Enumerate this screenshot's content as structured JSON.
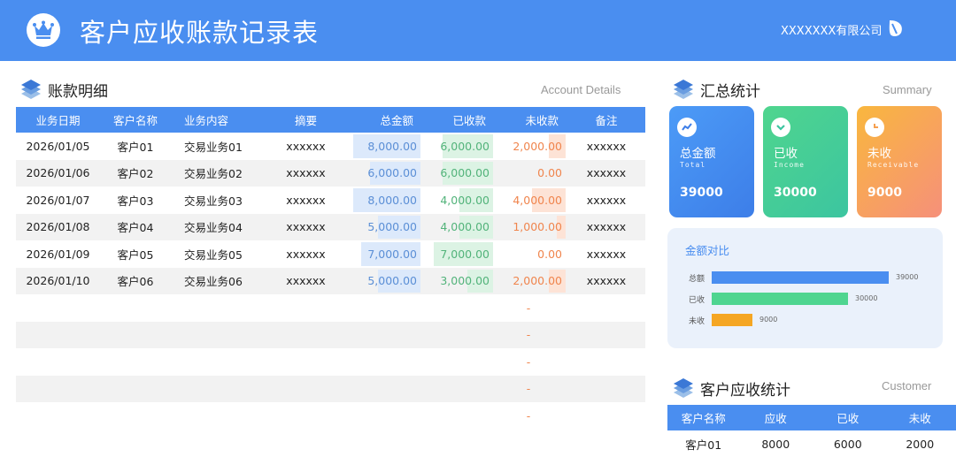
{
  "header": {
    "title": "客户应收账款记录表",
    "company": "XXXXXXX有限公司",
    "bg_color": "#4a8ef0"
  },
  "details": {
    "heading": "账款明细",
    "heading_en": "Account Details",
    "columns": [
      "业务日期",
      "客户名称",
      "业务内容",
      "摘要",
      "总金额",
      "已收款",
      "未收款",
      "备注"
    ],
    "max_amount": 8000,
    "rows": [
      {
        "date": "2026/01/05",
        "customer": "客户01",
        "content": "交易业务01",
        "summary": "xxxxxx",
        "total": "8,000.00",
        "received": "6,000.00",
        "outstanding": "2,000.00",
        "note": "xxxxxx",
        "total_v": 8000,
        "received_v": 6000,
        "outstanding_v": 2000
      },
      {
        "date": "2026/01/06",
        "customer": "客户02",
        "content": "交易业务02",
        "summary": "xxxxxx",
        "total": "6,000.00",
        "received": "6,000.00",
        "outstanding": "0.00",
        "note": "xxxxxx",
        "total_v": 6000,
        "received_v": 6000,
        "outstanding_v": 0
      },
      {
        "date": "2026/01/07",
        "customer": "客户03",
        "content": "交易业务03",
        "summary": "xxxxxx",
        "total": "8,000.00",
        "received": "4,000.00",
        "outstanding": "4,000.00",
        "note": "xxxxxx",
        "total_v": 8000,
        "received_v": 4000,
        "outstanding_v": 4000
      },
      {
        "date": "2026/01/08",
        "customer": "客户04",
        "content": "交易业务04",
        "summary": "xxxxxx",
        "total": "5,000.00",
        "received": "4,000.00",
        "outstanding": "1,000.00",
        "note": "xxxxxx",
        "total_v": 5000,
        "received_v": 4000,
        "outstanding_v": 1000
      },
      {
        "date": "2026/01/09",
        "customer": "客户05",
        "content": "交易业务05",
        "summary": "xxxxxx",
        "total": "7,000.00",
        "received": "7,000.00",
        "outstanding": "0.00",
        "note": "xxxxxx",
        "total_v": 7000,
        "received_v": 7000,
        "outstanding_v": 0
      },
      {
        "date": "2026/01/10",
        "customer": "客户06",
        "content": "交易业务06",
        "summary": "xxxxxx",
        "total": "5,000.00",
        "received": "3,000.00",
        "outstanding": "2,000.00",
        "note": "xxxxxx",
        "total_v": 5000,
        "received_v": 3000,
        "outstanding_v": 2000
      }
    ],
    "empty_placeholder": "-"
  },
  "summary": {
    "heading": "汇总统计",
    "heading_en": "Summary",
    "cards": [
      {
        "name": "总金额",
        "name_en": "Total",
        "value": "39000",
        "color_from": "#4c9bf7",
        "color_to": "#3d7ee8",
        "icon": "trend-icon"
      },
      {
        "name": "已收",
        "name_en": "Income",
        "value": "30000",
        "color_from": "#4fd58e",
        "color_to": "#3cc5a0",
        "icon": "check-icon"
      },
      {
        "name": "未收",
        "name_en": "Receivable",
        "value": "9000",
        "color_from": "#f9b73e",
        "color_to": "#f6907a",
        "icon": "clock-icon"
      }
    ]
  },
  "comparison": {
    "title": "金额对比",
    "chart_data": {
      "type": "bar",
      "orientation": "horizontal",
      "categories": [
        "总额",
        "已收",
        "未收"
      ],
      "values": [
        39000,
        30000,
        9000
      ],
      "colors": [
        "#4a8ef0",
        "#4fd590",
        "#f5a623"
      ]
    }
  },
  "customer": {
    "heading": "客户应收统计",
    "heading_en": "Customer",
    "columns": [
      "客户名称",
      "应收",
      "已收",
      "未收"
    ],
    "rows": [
      {
        "customer": "客户01",
        "due": "8000",
        "received": "6000",
        "outstanding": "2000"
      }
    ]
  }
}
